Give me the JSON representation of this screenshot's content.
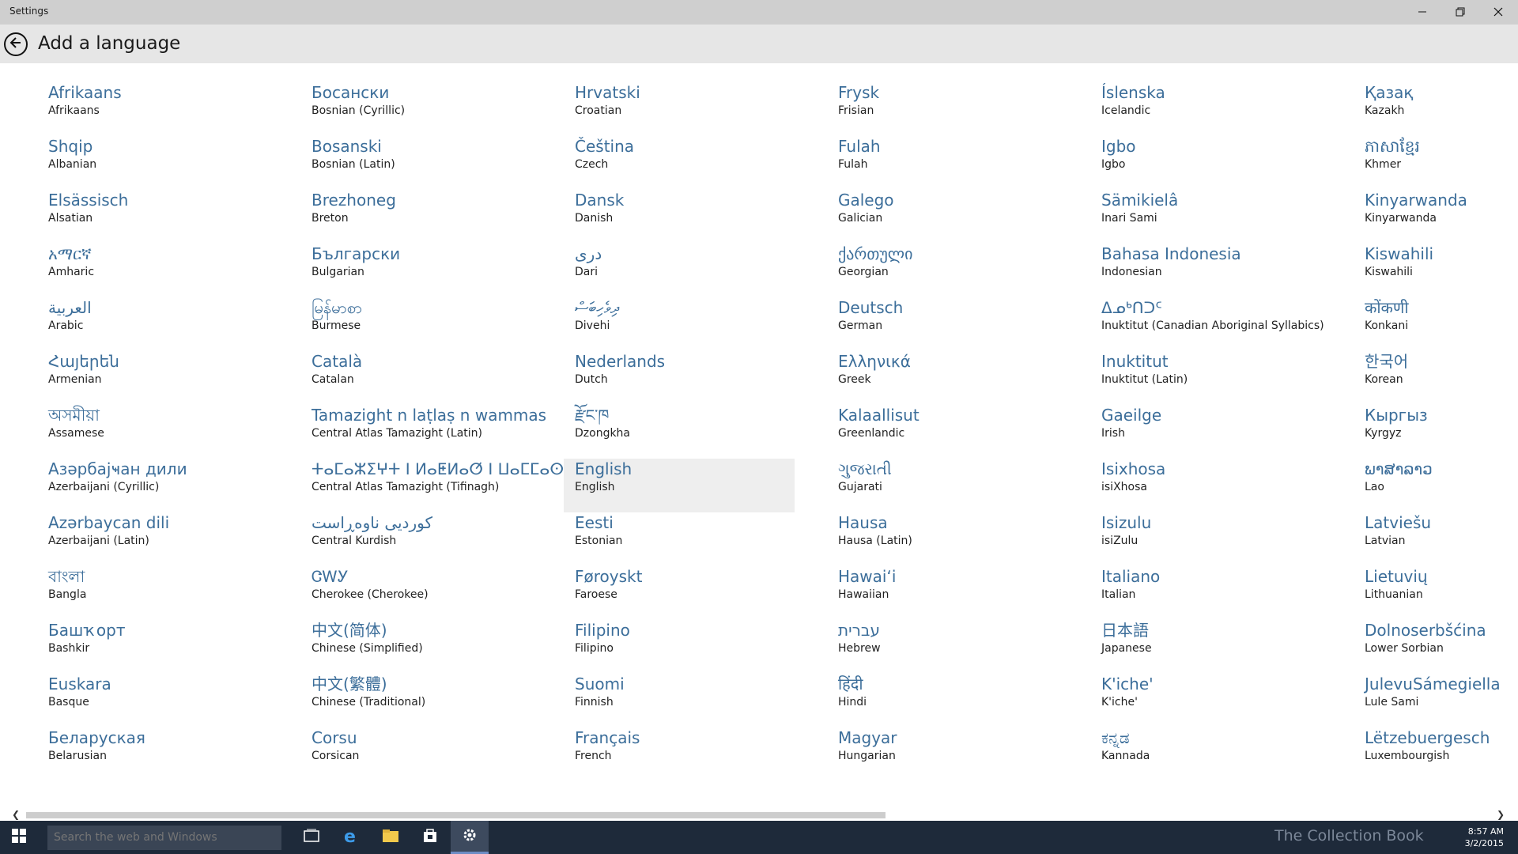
{
  "window": {
    "title": "Settings",
    "controls": [
      "minimize-icon",
      "restore-icon",
      "close-icon"
    ]
  },
  "header": {
    "title": "Add a language",
    "back_icon": "back-arrow-icon"
  },
  "columns": [
    [
      {
        "native": "Afrikaans",
        "english": "Afrikaans"
      },
      {
        "native": "Shqip",
        "english": "Albanian"
      },
      {
        "native": "Elsässisch",
        "english": "Alsatian"
      },
      {
        "native": "አማርኛ",
        "english": "Amharic"
      },
      {
        "native": "العربية",
        "english": "Arabic"
      },
      {
        "native": "Հայերեն",
        "english": "Armenian"
      },
      {
        "native": "অসমীয়া",
        "english": "Assamese"
      },
      {
        "native": "Азәрбајҹан дили",
        "english": "Azerbaijani (Cyrillic)"
      },
      {
        "native": "Azərbaycan dili",
        "english": "Azerbaijani (Latin)"
      },
      {
        "native": "বাংলা",
        "english": "Bangla"
      },
      {
        "native": "Башҡорт",
        "english": "Bashkir"
      },
      {
        "native": "Euskara",
        "english": "Basque"
      },
      {
        "native": "Беларуская",
        "english": "Belarusian"
      }
    ],
    [
      {
        "native": "Босански",
        "english": "Bosnian (Cyrillic)"
      },
      {
        "native": "Bosanski",
        "english": "Bosnian (Latin)"
      },
      {
        "native": "Brezhoneg",
        "english": "Breton"
      },
      {
        "native": "Български",
        "english": "Bulgarian"
      },
      {
        "native": "မြန်မာစာ",
        "english": "Burmese"
      },
      {
        "native": "Català",
        "english": "Catalan"
      },
      {
        "native": "Tamazight n laṭlaṣ n wammas",
        "english": "Central Atlas Tamazight (Latin)"
      },
      {
        "native": "ⵜⴰⵎⴰⵣⵉⵖⵜ ⵏ ⵍⴰⵟⵍⴰⵚ ⵏ ⵡⴰⵎⵎⴰⵙ",
        "english": "Central Atlas Tamazight (Tifinagh)"
      },
      {
        "native": "کوردیی ناوەڕاست",
        "english": "Central Kurdish"
      },
      {
        "native": "ᏣᎳᎩ",
        "english": "Cherokee (Cherokee)"
      },
      {
        "native": "中文(简体)",
        "english": "Chinese (Simplified)"
      },
      {
        "native": "中文(繁體)",
        "english": "Chinese (Traditional)"
      },
      {
        "native": "Corsu",
        "english": "Corsican"
      }
    ],
    [
      {
        "native": "Hrvatski",
        "english": "Croatian"
      },
      {
        "native": "Čeština",
        "english": "Czech"
      },
      {
        "native": "Dansk",
        "english": "Danish"
      },
      {
        "native": "درى",
        "english": "Dari"
      },
      {
        "native": "ދިވެހިބަސް",
        "english": "Divehi"
      },
      {
        "native": "Nederlands",
        "english": "Dutch"
      },
      {
        "native": "རྫོང་ཁ",
        "english": "Dzongkha"
      },
      {
        "native": "English",
        "english": "English",
        "selected": true
      },
      {
        "native": "Eesti",
        "english": "Estonian"
      },
      {
        "native": "Føroyskt",
        "english": "Faroese"
      },
      {
        "native": "Filipino",
        "english": "Filipino"
      },
      {
        "native": "Suomi",
        "english": "Finnish"
      },
      {
        "native": "Français",
        "english": "French"
      }
    ],
    [
      {
        "native": "Frysk",
        "english": "Frisian"
      },
      {
        "native": "Fulah",
        "english": "Fulah"
      },
      {
        "native": "Galego",
        "english": "Galician"
      },
      {
        "native": "ქართული",
        "english": "Georgian"
      },
      {
        "native": "Deutsch",
        "english": "German"
      },
      {
        "native": "Ελληνικά",
        "english": "Greek"
      },
      {
        "native": "Kalaallisut",
        "english": "Greenlandic"
      },
      {
        "native": "ગુજરાતી",
        "english": "Gujarati"
      },
      {
        "native": "Hausa",
        "english": "Hausa (Latin)"
      },
      {
        "native": "Hawaiʻi",
        "english": "Hawaiian"
      },
      {
        "native": "עברית",
        "english": "Hebrew"
      },
      {
        "native": "हिंदी",
        "english": "Hindi"
      },
      {
        "native": "Magyar",
        "english": "Hungarian"
      }
    ],
    [
      {
        "native": "Íslenska",
        "english": "Icelandic"
      },
      {
        "native": "Igbo",
        "english": "Igbo"
      },
      {
        "native": "Sämikielâ",
        "english": "Inari Sami"
      },
      {
        "native": "Bahasa Indonesia",
        "english": "Indonesian"
      },
      {
        "native": "ᐃᓄᒃᑎᑐᑦ",
        "english": "Inuktitut (Canadian Aboriginal Syllabics)"
      },
      {
        "native": "Inuktitut",
        "english": "Inuktitut (Latin)"
      },
      {
        "native": "Gaeilge",
        "english": "Irish"
      },
      {
        "native": "Isixhosa",
        "english": "isiXhosa"
      },
      {
        "native": "Isizulu",
        "english": "isiZulu"
      },
      {
        "native": "Italiano",
        "english": "Italian"
      },
      {
        "native": "日本語",
        "english": "Japanese"
      },
      {
        "native": "K'iche'",
        "english": "K'iche'"
      },
      {
        "native": "ಕನ್ನಡ",
        "english": "Kannada"
      }
    ],
    [
      {
        "native": "Қазақ",
        "english": "Kazakh"
      },
      {
        "native": "ភាសាខ្មែរ",
        "english": "Khmer"
      },
      {
        "native": "Kinyarwanda",
        "english": "Kinyarwanda"
      },
      {
        "native": "Kiswahili",
        "english": "Kiswahili"
      },
      {
        "native": "कोंकणी",
        "english": "Konkani"
      },
      {
        "native": "한국어",
        "english": "Korean"
      },
      {
        "native": "Кыргыз",
        "english": "Kyrgyz"
      },
      {
        "native": "ພາສາລາວ",
        "english": "Lao"
      },
      {
        "native": "Latviešu",
        "english": "Latvian"
      },
      {
        "native": "Lietuvių",
        "english": "Lithuanian"
      },
      {
        "native": "Dolnoserbšćina",
        "english": "Lower Sorbian"
      },
      {
        "native": "JulevuSámegiella",
        "english": "Lule Sami"
      },
      {
        "native": "Lëtzebuergesch",
        "english": "Luxembourgish"
      }
    ]
  ],
  "scrollbar": {
    "left_icon": "chevron-left-icon",
    "right_icon": "chevron-right-icon",
    "position_fraction": 0.0
  },
  "taskbar": {
    "start_icon": "windows-logo-icon",
    "search_placeholder": "Search the web and Windows",
    "apps": [
      "task-view-icon",
      "internet-explorer-icon",
      "file-explorer-icon",
      "store-icon",
      "settings-gear-icon"
    ],
    "watermark": "The Collection Book",
    "clock_time": "8:57 AM",
    "clock_date": "3/2/2015"
  },
  "colors": {
    "link_blue": "#3c6e9a",
    "title_bar": "#cfcfcf",
    "header_bar": "#e6e6e6",
    "taskbar": "#1e2a3a",
    "selected_row": "#eeeeee"
  }
}
